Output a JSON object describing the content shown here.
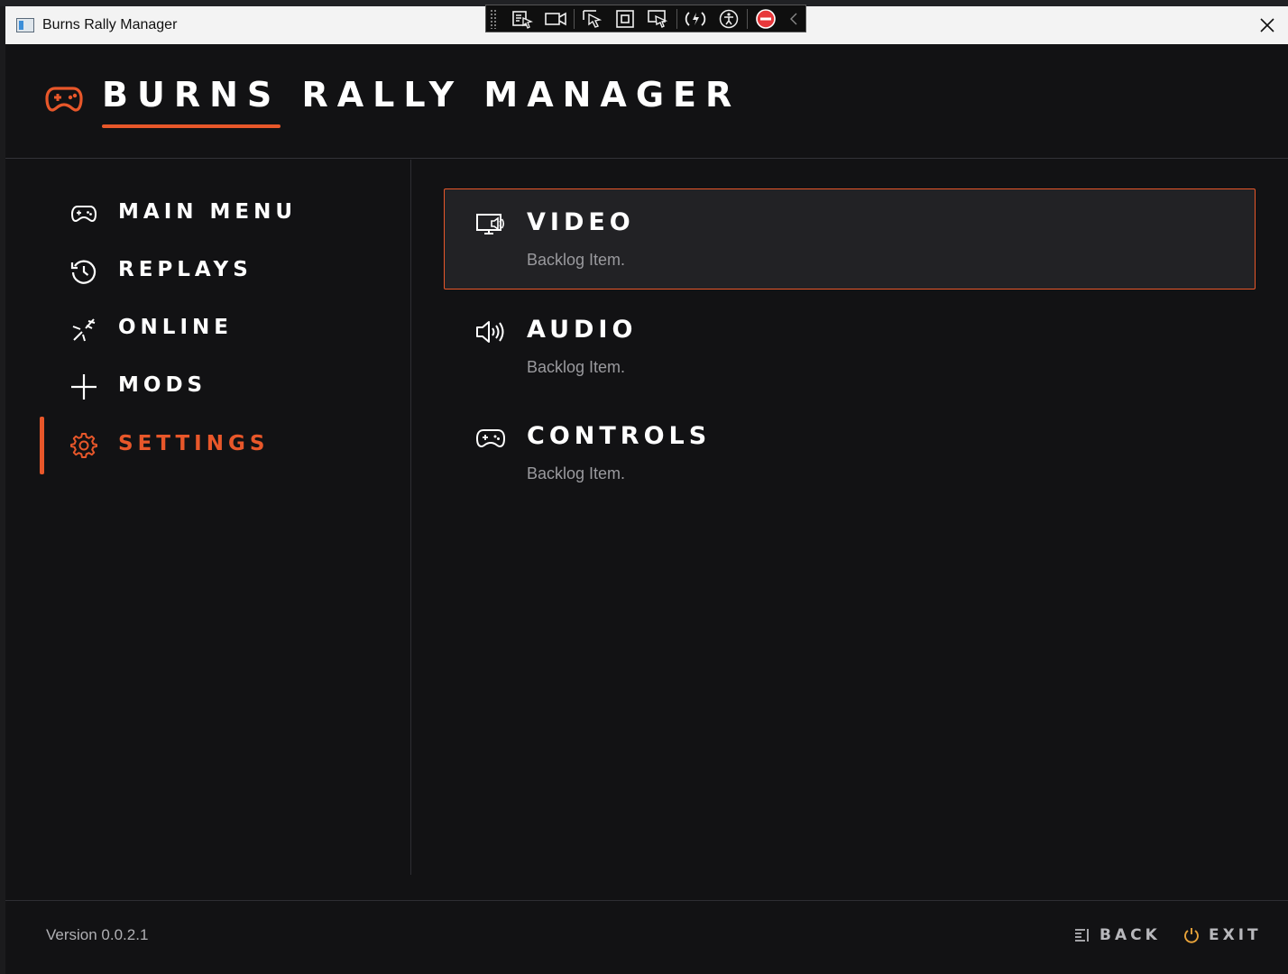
{
  "window": {
    "title": "Burns Rally Manager",
    "close_icon": "close-icon"
  },
  "debug_toolbar": {
    "icons": [
      "select-element-icon",
      "video-record-icon",
      "pointer-icon",
      "frame-icon",
      "touch-pointer-icon",
      "hot-reload-icon",
      "accessibility-icon",
      "stop-icon",
      "collapse-chevron-icon"
    ]
  },
  "header": {
    "title": "BURNS RALLY MANAGER",
    "icon": "gamepad-icon",
    "accent_color": "#e8572a"
  },
  "sidebar": {
    "items": [
      {
        "label": "MAIN MENU",
        "icon": "gamepad-icon",
        "active": false
      },
      {
        "label": "REPLAYS",
        "icon": "history-icon",
        "active": false
      },
      {
        "label": "ONLINE",
        "icon": "disconnected-icon",
        "active": false
      },
      {
        "label": "MODS",
        "icon": "plus-icon",
        "active": false
      },
      {
        "label": "SETTINGS",
        "icon": "gear-icon",
        "active": true
      }
    ]
  },
  "settings": {
    "items": [
      {
        "title": "VIDEO",
        "subtitle": "Backlog Item.",
        "icon": "display-sound-icon",
        "selected": true
      },
      {
        "title": "AUDIO",
        "subtitle": "Backlog Item.",
        "icon": "speaker-icon",
        "selected": false
      },
      {
        "title": "CONTROLS",
        "subtitle": "Backlog Item.",
        "icon": "gamepad-icon",
        "selected": false
      }
    ]
  },
  "footer": {
    "version": "Version 0.0.2.1",
    "back_label": "BACK",
    "back_icon": "back-menu-icon",
    "exit_label": "EXIT",
    "exit_icon": "power-icon",
    "exit_icon_color": "#e8a33a"
  }
}
